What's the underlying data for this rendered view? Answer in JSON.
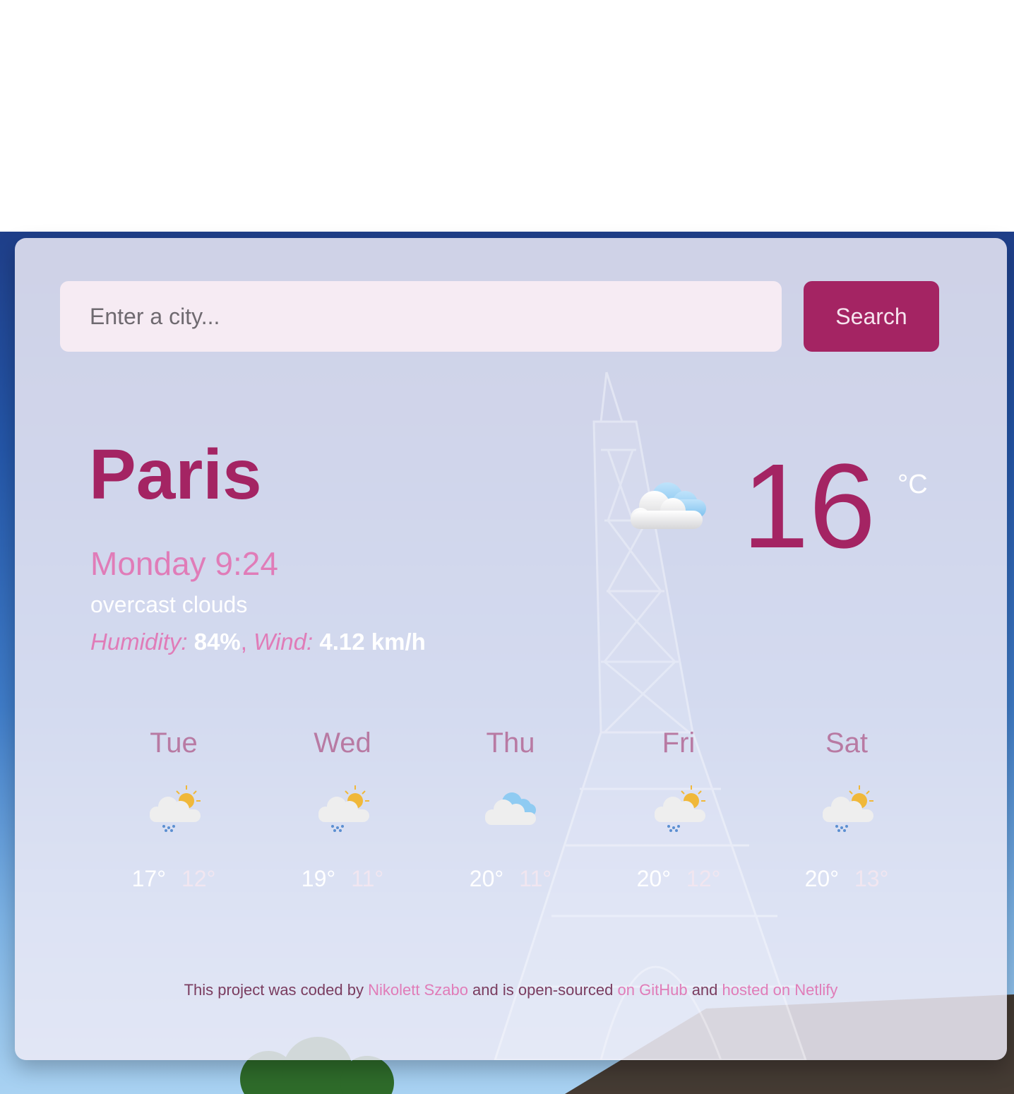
{
  "search": {
    "placeholder": "Enter a city...",
    "value": "",
    "button_label": "Search"
  },
  "current": {
    "city": "Paris",
    "datetime": "Monday 9:24",
    "description": "overcast clouds",
    "humidity_label": "Humidity:",
    "humidity_value": "84%",
    "separator": ",",
    "wind_label": "Wind:",
    "wind_value": "4.12 km/h",
    "icon": "overcast-clouds-icon",
    "temperature": "16",
    "unit": "°C"
  },
  "forecast": [
    {
      "day": "Tue",
      "icon": "sun-rain-clouds-icon",
      "max": "17°",
      "min": "12°"
    },
    {
      "day": "Wed",
      "icon": "sun-rain-clouds-icon",
      "max": "19°",
      "min": "11°"
    },
    {
      "day": "Thu",
      "icon": "clouds-icon",
      "max": "20°",
      "min": "11°"
    },
    {
      "day": "Fri",
      "icon": "sun-rain-clouds-icon",
      "max": "20°",
      "min": "12°"
    },
    {
      "day": "Sat",
      "icon": "sun-rain-clouds-icon",
      "max": "20°",
      "min": "13°"
    }
  ],
  "footer": {
    "text_1": "This project was coded by ",
    "author_link": "Nikolett Szabo",
    "text_2": " and is open-sourced ",
    "github_link": "on GitHub",
    "text_3": " and ",
    "netlify_link": "hosted on Netlify"
  },
  "colors": {
    "accent": "#a42463",
    "pink": "#e07cb8",
    "input_bg": "#f6ebf3"
  }
}
